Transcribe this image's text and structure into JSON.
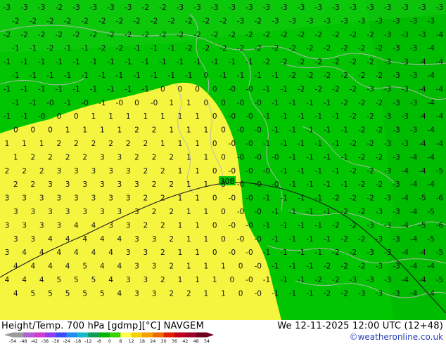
{
  "map": {
    "contour_label": "308",
    "grid_values": {
      "rows": [
        "-3 -3 -3 -2 -3 -3 -3 -3 -2 -2 -3 -3 -3 -3 -3 -3 -3 -3 -3 -3 -3 -3 -3 -3 -3 -3",
        "-2 -2 -2 -2 -2 -2 -2 -2 -2 -2 -2 -2 -2 -3 -2 -3 -3 -3 -3 -3 -3 -3 -3 -3 -3 -4",
        "-2 -2 -2 -2 -2 -2 -2 -2 -2 -2 -2 -2 -2 -2 -2 -2 -2 -2 -2 -2 -2 -2 -3 -3 -3 -4",
        "-1 -1 -2 -1 -1 -2 -2 -1 -1 -1 -2 -2 -2 -2 -2 -2 -2 -2 -2 -2 -2 -2 -3 -3 -4 -4",
        "-1 -1 -1 -1 -1 -1 -1 -1 -1 -1 -1 -1 -1 -1 -1 -2 -2 -2 -2 -2 -2 -2 -3 -3 -4 -4",
        "-1 -1 -1 -1 -1 -1 -1 -1 -1 -1 -1 0 -1 -1 -1 -1 -2 -2 -2 -2 -2 -2 -3 -3 -4 -4",
        "-1 -1 -1 -1 -1 -1 -1 -1 -1 0 0 0 0 -0 -0 -1 -1 -2 -2 -2 -2 -3 -3 -3 -4 -4",
        "-1 -1 -0 -1 -0 -1 -0 0 -0 1 1 0 0 -0 -0 -1 -1 -1 -1 -2 -2 -2 -3 -3 -4 -4",
        "-1 -1 -0 0 0 1 1 1 1 1 1 1 0 -0 -0 -1 -1 -1 -1 -1 -2 -2 -3 -3 -4 -4",
        "0 0 0 1 1 1 1 2 2 1 1 1 0 -0 -0 -1 -1 -1 -1 -1 -2 -2 -3 -3 -4 -4",
        "1 1 1 2 2 2 2 2 2 1 1 1 0 -0 -0 -1 -1 -1 -1 -1 -2 -2 -3 -3 -4 -4",
        "1 2 2 2 2 3 3 2 2 2 1 1 0 -0 -0 -0 -1 -1 -1 -1 -2 -2 -3 -4 -4 -5",
        "2 2 2 3 3 3 3 3 2 2 1 1 0 -0 -0 -0 -1 -1 -1 -1 -2 -2 -3 -4 -4 -5",
        "2 2 3 3 3 3 3 3 2 2 1 1 0 -0 -0 -0 -1 -1 -1 -1 -2 -2 -3 -4 -4 -5",
        "3 3 3 3 3 3 3 3 2 2 1 1 0 -0 -0 -1 -1 -1 -1 -2 -2 -2 -3 -4 -5 -6",
        "3 3 3 3 3 3 3 3 2 2 1 1 0 -0 -0 -1 -1 -1 -1 -2 -2 -3 -3 -4 -5 -5",
        "3 3 3 3 4 4 3 3 2 2 1 1 0 -0 -0 -1 -1 -1 -1 -2 -2 -3 -3 -4 -5 -6",
        "3 3 4 4 4 4 4 3 3 2 1 1 0 -0 -0 -1 -1 -1 -1 -2 -2 -3 -3 -4 -5 -5",
        "3 4 4 4 4 4 4 3 3 2 1 1 0 -0 -0 -1 -1 -1 -1 -2 -2 -3 -3 -4 -4 -5",
        "4 4 4 4 5 4 4 3 3 2 1 1 1 0 -0 -1 -1 -1 -2 -2 -2 -3 -3 -4 -4 -5",
        "4 4 4 5 5 5 4 3 3 2 1 1 1 0 -0 -1 -1 -1 -2 -2 -3 -3 -3 -4 -4 -5",
        "4 5 5 5 5 5 4 3 3 2 2 1 1 0 -0 -1 -1 -1 -2 -2 -3 -3 -3 -4 -4 -5"
      ]
    }
  },
  "footer": {
    "title_left": "Height/Temp. 700 hPa [gdmp][°C] NAVGEM",
    "title_right": "We 12-11-2025 12:00 UTC (12+48)",
    "credit": "©weatheronline.co.uk",
    "scale_labels": [
      "-54",
      "-48",
      "-42",
      "-38",
      "-30",
      "-24",
      "-18",
      "-12",
      "-8",
      "0",
      "8",
      "12",
      "18",
      "24",
      "30",
      "36",
      "42",
      "48",
      "54"
    ],
    "scale_colors": [
      "#9b9b9b",
      "#b05fd0",
      "#d23bd2",
      "#8e3ef0",
      "#3b4cf5",
      "#1f8ef0",
      "#18b8c8",
      "#0f9d58",
      "#00b800",
      "#39d100",
      "#ffff4d",
      "#f4d000",
      "#f4a000",
      "#ea6a00",
      "#e02000",
      "#c0001a",
      "#a00028",
      "#6b0020"
    ]
  }
}
